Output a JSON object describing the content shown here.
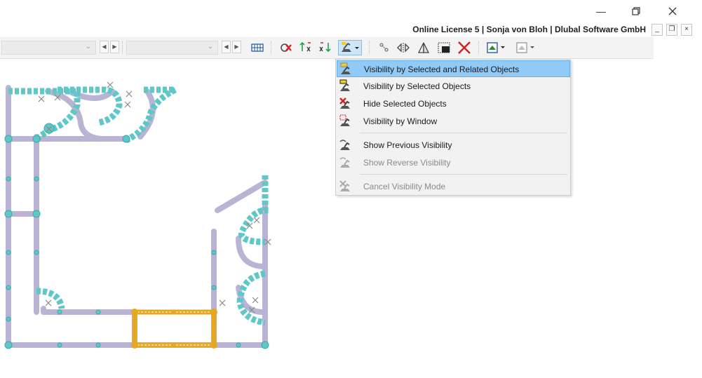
{
  "window": {
    "minimize_glyph": "—",
    "restore_glyph": "❐",
    "close_glyph": "✕"
  },
  "license": {
    "text": "Online License 5 | Sonja von Bloh | Dlubal Software GmbH",
    "mdi_minimize": "_",
    "mdi_restore": "❐",
    "mdi_close": "×"
  },
  "toolbar": {
    "combo1_value": "",
    "combo2_value": "",
    "icons": [
      "grid-icon",
      "delete-selection-icon",
      "sort-ascending-icon",
      "sort-descending-icon",
      "visibility-dropdown-icon",
      "node-tool-icon",
      "mirror-icon",
      "symmetry-icon",
      "window-select-icon",
      "cancel-x-icon",
      "view-icon",
      "view-disabled-icon"
    ]
  },
  "menu": {
    "items": [
      {
        "label": "Visibility by Selected and Related Objects",
        "highlighted": true,
        "enabled": true,
        "icon": "visibility-selected-related-icon"
      },
      {
        "label": "Visibility by Selected Objects",
        "highlighted": false,
        "enabled": true,
        "icon": "visibility-selected-icon"
      },
      {
        "label": "Hide Selected Objects",
        "highlighted": false,
        "enabled": true,
        "icon": "hide-selected-icon"
      },
      {
        "label": "Visibility by Window",
        "highlighted": false,
        "enabled": true,
        "icon": "visibility-window-icon"
      },
      {
        "label": "Show Previous Visibility",
        "highlighted": false,
        "enabled": true,
        "icon": "previous-visibility-icon"
      },
      {
        "label": "Show Reverse Visibility",
        "highlighted": false,
        "enabled": false,
        "icon": "reverse-visibility-icon"
      },
      {
        "label": "Cancel Visibility Mode",
        "highlighted": false,
        "enabled": false,
        "icon": "cancel-visibility-icon"
      }
    ]
  },
  "colors": {
    "member": "#b9b4d4",
    "node": "#5ec8c8",
    "selected": "#e5a820",
    "highlight": "#91c9f7"
  }
}
